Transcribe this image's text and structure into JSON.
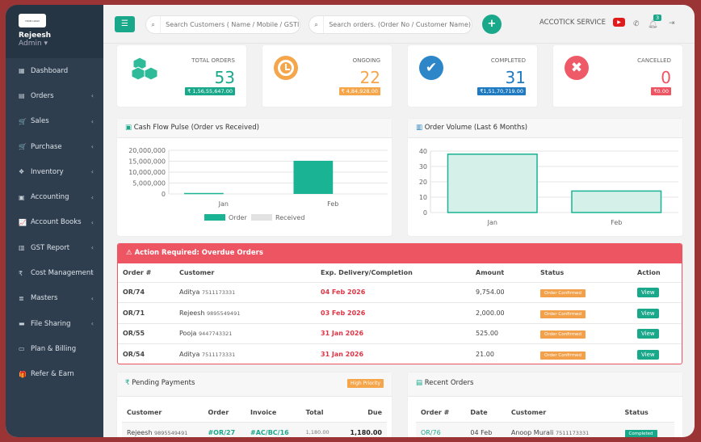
{
  "sidebar": {
    "logo": "YOUR LOGO",
    "user": "Rejeesh",
    "role": "Admin ▾",
    "items": [
      {
        "label": "Dashboard",
        "icon": "▦"
      },
      {
        "label": "Orders",
        "icon": "▤"
      },
      {
        "label": "Sales",
        "icon": "🛒"
      },
      {
        "label": "Purchase",
        "icon": "🛒"
      },
      {
        "label": "Inventory",
        "icon": "❖"
      },
      {
        "label": "Accounting",
        "icon": "▣"
      },
      {
        "label": "Account Books",
        "icon": "📈"
      },
      {
        "label": "GST Report",
        "icon": "▥"
      },
      {
        "label": "Cost Management",
        "icon": "₹"
      },
      {
        "label": "Masters",
        "icon": "≣"
      },
      {
        "label": "File Sharing",
        "icon": "▬"
      },
      {
        "label": "Plan & Billing",
        "icon": "▭"
      },
      {
        "label": "Refer & Earn",
        "icon": "🎁"
      }
    ]
  },
  "topbar": {
    "customer_search_placeholder": "Search Customers ( Name / Mobile / GSTIN )",
    "order_search_placeholder": "Search orders. (Order No / Customer Name)",
    "service": "ACCOTICK SERVICE",
    "notifications": "3"
  },
  "stats": [
    {
      "label": "TOTAL ORDERS",
      "value": "53",
      "amount": "₹ 1,56,55,647.00",
      "color": "#1aa88b"
    },
    {
      "label": "ONGOING",
      "value": "22",
      "amount": "₹ 4,84,928.00",
      "color": "#f5a54a"
    },
    {
      "label": "COMPLETED",
      "value": "31",
      "amount": "₹1,51,70,719.00",
      "color": "#1f7bc1"
    },
    {
      "label": "CANCELLED",
      "value": "0",
      "amount": "₹0.00",
      "color": "#ee5563"
    }
  ],
  "chart_data": [
    {
      "type": "bar",
      "title": "Cash Flow Pulse (Order vs Received)",
      "categories": [
        "Jan",
        "Feb"
      ],
      "series": [
        {
          "name": "Order",
          "values": [
            450000,
            15200000
          ],
          "color": "#1ab394"
        },
        {
          "name": "Received",
          "values": [
            0,
            0
          ],
          "color": "#e2e2e2"
        }
      ],
      "ylim": [
        0,
        20000000
      ],
      "yticks": [
        "20,000,000",
        "15,000,000",
        "10,000,000",
        "5,000,000",
        "0"
      ],
      "legend": "bottom",
      "grid": true
    },
    {
      "type": "bar",
      "title": "Order Volume (Last 6 Months)",
      "categories": [
        "Jan",
        "Feb"
      ],
      "values": [
        38,
        14
      ],
      "ylim": [
        0,
        40
      ],
      "yticks": [
        "40",
        "30",
        "20",
        "10",
        "0"
      ],
      "grid": true
    }
  ],
  "overdue": {
    "title": "Action Required: Overdue Orders",
    "columns": [
      "Order #",
      "Customer",
      "Exp. Delivery/Completion",
      "Amount",
      "Status",
      "Action"
    ],
    "rows": [
      {
        "order": "OR/74",
        "customer": "Aditya",
        "phone": "7511173331",
        "date": "04 Feb 2026",
        "amount": "9,754.00",
        "status": "Order Confirmed",
        "action": "View"
      },
      {
        "order": "OR/71",
        "customer": "Rejeesh",
        "phone": "9895549491",
        "date": "03 Feb 2026",
        "amount": "2,000.00",
        "status": "Order Confirmed",
        "action": "View"
      },
      {
        "order": "OR/55",
        "customer": "Pooja",
        "phone": "9447743321",
        "date": "31 Jan 2026",
        "amount": "525.00",
        "status": "Order Confirmed",
        "action": "View"
      },
      {
        "order": "OR/54",
        "customer": "Aditya",
        "phone": "7511173331",
        "date": "31 Jan 2026",
        "amount": "21.00",
        "status": "Order Confirmed",
        "action": "View"
      }
    ]
  },
  "pending": {
    "title": "Pending Payments",
    "badge": "High Priority",
    "columns": [
      "Customer",
      "Order",
      "Invoice",
      "Total",
      "Due"
    ],
    "rows": [
      {
        "customer": "Rejeesh",
        "phone": "9895549491",
        "order": "#OR/27",
        "invoice": "#AC/BC/16",
        "total": "1,180.00",
        "due": "1,180.00"
      }
    ]
  },
  "recent": {
    "title": "Recent Orders",
    "columns": [
      "Order #",
      "Date",
      "Customer",
      "Status"
    ],
    "rows": [
      {
        "order": "OR/76",
        "date": "04 Feb",
        "customer": "Anoop Murali",
        "phone": "7511173331",
        "status": "Completed"
      }
    ]
  }
}
